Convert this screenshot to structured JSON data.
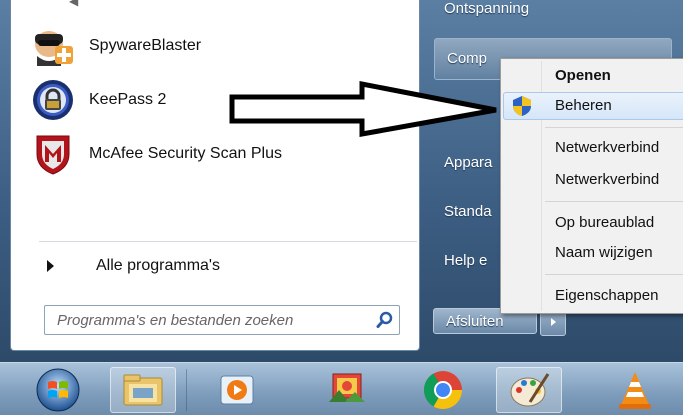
{
  "start_menu": {
    "programs": [
      {
        "label": "SpywareBlaster",
        "icon": "spywareblaster-icon"
      },
      {
        "label": "KeePass 2",
        "icon": "keepass-icon"
      },
      {
        "label": "McAfee Security Scan Plus",
        "icon": "mcafee-icon"
      }
    ],
    "all_programs_label": "Alle programma's",
    "search_placeholder": "Programma's en bestanden zoeken"
  },
  "right_pane": {
    "items": [
      "Ontspanning",
      "Computer",
      "Appara",
      "Standa",
      "Help e"
    ],
    "computer_label": "Comp",
    "shutdown_label": "Afsluiten"
  },
  "context_menu": {
    "items": [
      "Openen",
      "Beheren",
      "Netwerkverbind",
      "Netwerkverbind",
      "Op bureaublad",
      "Naam wijzigen",
      "Eigenschappen"
    ],
    "highlighted_index": 1
  },
  "taskbar": {
    "apps": [
      "start-orb",
      "windows-explorer",
      "media-center",
      "photo-gallery",
      "chrome",
      "paint",
      "vlc"
    ]
  },
  "colors": {
    "menu_accent": "#3d5f84",
    "highlight": "#d5e6f8"
  }
}
